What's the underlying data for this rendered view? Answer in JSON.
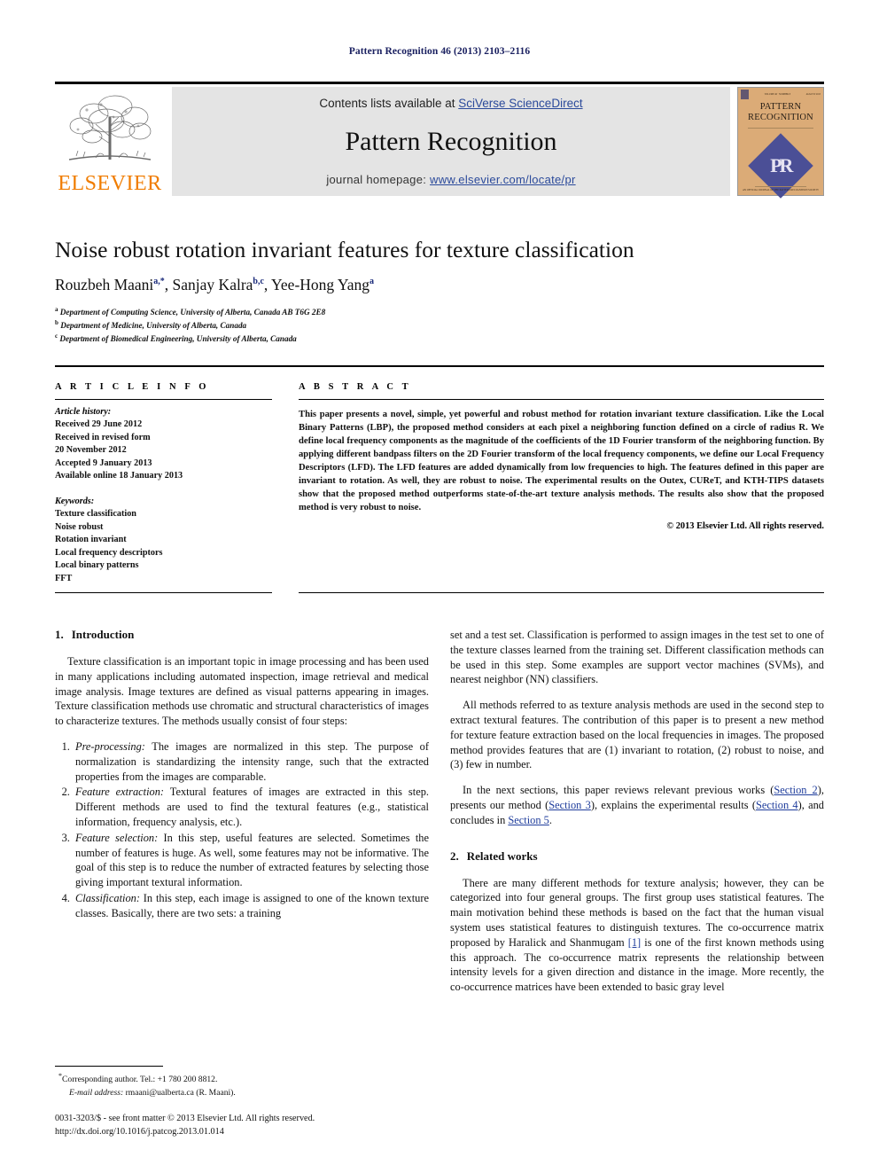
{
  "running_head": "Pattern Recognition 46 (2013) 2103–2116",
  "masthead": {
    "contents_prefix": "Contents lists available at ",
    "contents_link": "SciVerse ScienceDirect",
    "journal_name": "Pattern Recognition",
    "homepage_prefix": "journal homepage: ",
    "homepage_link": "www.elsevier.com/locate/pr",
    "publisher_logo_text": "ELSEVIER",
    "cover": {
      "line1": "PATTERN",
      "line2": "RECOGNITION",
      "monogram": "PR",
      "top_left_tiny": "VOLUME 46 · NUMBER 8",
      "top_right_tiny": "AUGUST 2013",
      "bottom_tiny": "AN OFFICIAL JOURNAL OF THE PATTERN RECOGNITION SOCIETY"
    }
  },
  "article": {
    "title": "Noise robust rotation invariant features for texture classification",
    "authors": [
      {
        "name": "Rouzbeh Maani",
        "marks": "a,*"
      },
      {
        "name": "Sanjay Kalra",
        "marks": "b,c"
      },
      {
        "name": "Yee-Hong Yang",
        "marks": "a"
      }
    ],
    "affiliations": [
      {
        "mark": "a",
        "text": "Department of Computing Science, University of Alberta, Canada AB T6G 2E8"
      },
      {
        "mark": "b",
        "text": "Department of Medicine, University of Alberta, Canada"
      },
      {
        "mark": "c",
        "text": "Department of Biomedical Engineering, University of Alberta, Canada"
      }
    ]
  },
  "article_info": {
    "label": "A R T I C L E   I N F O",
    "history_title": "Article history:",
    "history_lines": [
      "Received 29 June 2012",
      "Received in revised form",
      "20 November 2012",
      "Accepted 9 January 2013",
      "Available online 18 January 2013"
    ],
    "keywords_title": "Keywords:",
    "keywords": [
      "Texture classification",
      "Noise robust",
      "Rotation invariant",
      "Local frequency descriptors",
      "Local binary patterns",
      "FFT"
    ]
  },
  "abstract": {
    "label": "A B S T R A C T",
    "text": "This paper presents a novel, simple, yet powerful and robust method for rotation invariant texture classification. Like the Local Binary Patterns (LBP), the proposed method considers at each pixel a neighboring function defined on a circle of radius R. We define local frequency components as the magnitude of the coefficients of the 1D Fourier transform of the neighboring function. By applying different bandpass filters on the 2D Fourier transform of the local frequency components, we define our Local Frequency Descriptors (LFD). The LFD features are added dynamically from low frequencies to high. The features defined in this paper are invariant to rotation. As well, they are robust to noise. The experimental results on the Outex, CUReT, and KTH-TIPS datasets show that the proposed method outperforms state-of-the-art texture analysis methods. The results also show that the proposed method is very robust to noise.",
    "copyright": "© 2013 Elsevier Ltd. All rights reserved."
  },
  "sections": {
    "intro": {
      "number": "1.",
      "title": "Introduction",
      "p1": "Texture classification is an important topic in image processing and has been used in many applications including automated inspection, image retrieval and medical image analysis. Image textures are defined as visual patterns appearing in images. Texture classification methods use chromatic and structural characteristics of images to characterize textures. The methods usually consist of four steps:",
      "steps": [
        {
          "term": "Pre-processing:",
          "text": " The images are normalized in this step. The purpose of normalization is standardizing the intensity range, such that the extracted properties from the images are comparable."
        },
        {
          "term": "Feature extraction:",
          "text": " Textural features of images are extracted in this step. Different methods are used to find the textural features (e.g., statistical information, frequency analysis, etc.)."
        },
        {
          "term": "Feature selection:",
          "text": " In this step, useful features are selected. Sometimes the number of features is huge. As well, some features may not be informative. The goal of this step is to reduce the number of extracted features by selecting those giving important textural information."
        },
        {
          "term": "Classification:",
          "text": " In this step, each image is assigned to one of the known texture classes. Basically, there are two sets: a training"
        }
      ]
    },
    "right_col": {
      "p_cont": "set and a test set. Classification is performed to assign images in the test set to one of the texture classes learned from the training set. Different classification methods can be used in this step. Some examples are support vector machines (SVMs), and nearest neighbor (NN) classifiers.",
      "p2": "All methods referred to as texture analysis methods are used in the second step to extract textural features. The contribution of this paper is to present a new method for texture feature extraction based on the local frequencies in images. The proposed method provides features that are (1) invariant to rotation, (2) robust to noise, and (3) few in number.",
      "p3_a": "In the next sections, this paper reviews relevant previous works (",
      "p3_link1": "Section 2",
      "p3_b": "), presents our method (",
      "p3_link2": "Section 3",
      "p3_c": "), explains the experimental results (",
      "p3_link3": "Section 4",
      "p3_d": "), and concludes in ",
      "p3_link4": "Section 5",
      "p3_e": "."
    },
    "related": {
      "number": "2.",
      "title": "Related works",
      "p1_a": "There are many different methods for texture analysis; however, they can be categorized into four general groups. The first group uses statistical features. The main motivation behind these methods is based on the fact that the human visual system uses statistical features to distinguish textures. The co-occurrence matrix proposed by Haralick and Shanmugam ",
      "p1_ref": "[1]",
      "p1_b": " is one of the first known methods using this approach. The co-occurrence matrix represents the relationship between intensity levels for a given direction and distance in the image. More recently, the co-occurrence matrices have been extended to basic gray level"
    }
  },
  "footnotes": {
    "corresponding": "Corresponding author. Tel.: +1 780 200 8812.",
    "email_label": "E-mail address:",
    "email_value": " rmaani@ualberta.ca (R. Maani).",
    "issn_line": "0031-3203/$ - see front matter © 2013 Elsevier Ltd. All rights reserved.",
    "doi_line": "http://dx.doi.org/10.1016/j.patcog.2013.01.014"
  },
  "colors": {
    "link_blue": "#2b4a9b",
    "ref_blue": "#1f3d9c",
    "elsevier_orange": "#f07c00",
    "band_gray": "#e4e4e4",
    "cover_tan": "#dbab77",
    "cover_purple": "#4b4f96",
    "runhead_navy": "#1a2060"
  }
}
